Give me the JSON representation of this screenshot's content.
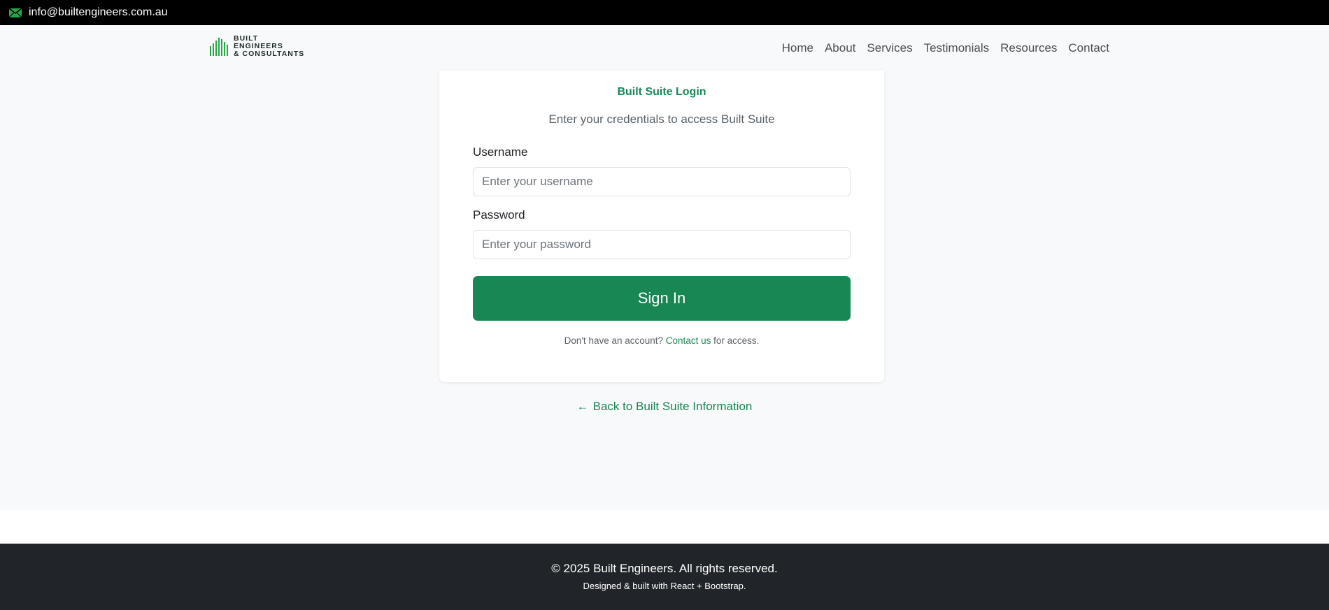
{
  "topbar": {
    "email": "info@builtengineers.com.au",
    "icon": "mail-icon"
  },
  "brand": {
    "line1": "BUILT",
    "line2": "ENGINEERS",
    "line3": "& CONSULTANTS",
    "accent": "#28a745"
  },
  "nav": {
    "items": [
      {
        "label": "Home"
      },
      {
        "label": "About"
      },
      {
        "label": "Services"
      },
      {
        "label": "Testimonials"
      },
      {
        "label": "Resources"
      },
      {
        "label": "Contact"
      }
    ]
  },
  "login": {
    "title": "Built Suite Login",
    "subtitle": "Enter your credentials to access Built Suite",
    "username_label": "Username",
    "username_placeholder": "Enter your username",
    "username_value": "",
    "password_label": "Password",
    "password_placeholder": "Enter your password",
    "password_value": "",
    "submit_label": "Sign In",
    "no_account_text": "Don't have an account?",
    "contact_link": "Contact us",
    "for_access_text": "for access.",
    "primary_color": "#198754"
  },
  "back": {
    "arrow": "←",
    "label": "Back to Built Suite Information"
  },
  "footer": {
    "copyright": "© 2025 Built Engineers. All rights reserved.",
    "designed": "Designed & built with React + Bootstrap."
  }
}
